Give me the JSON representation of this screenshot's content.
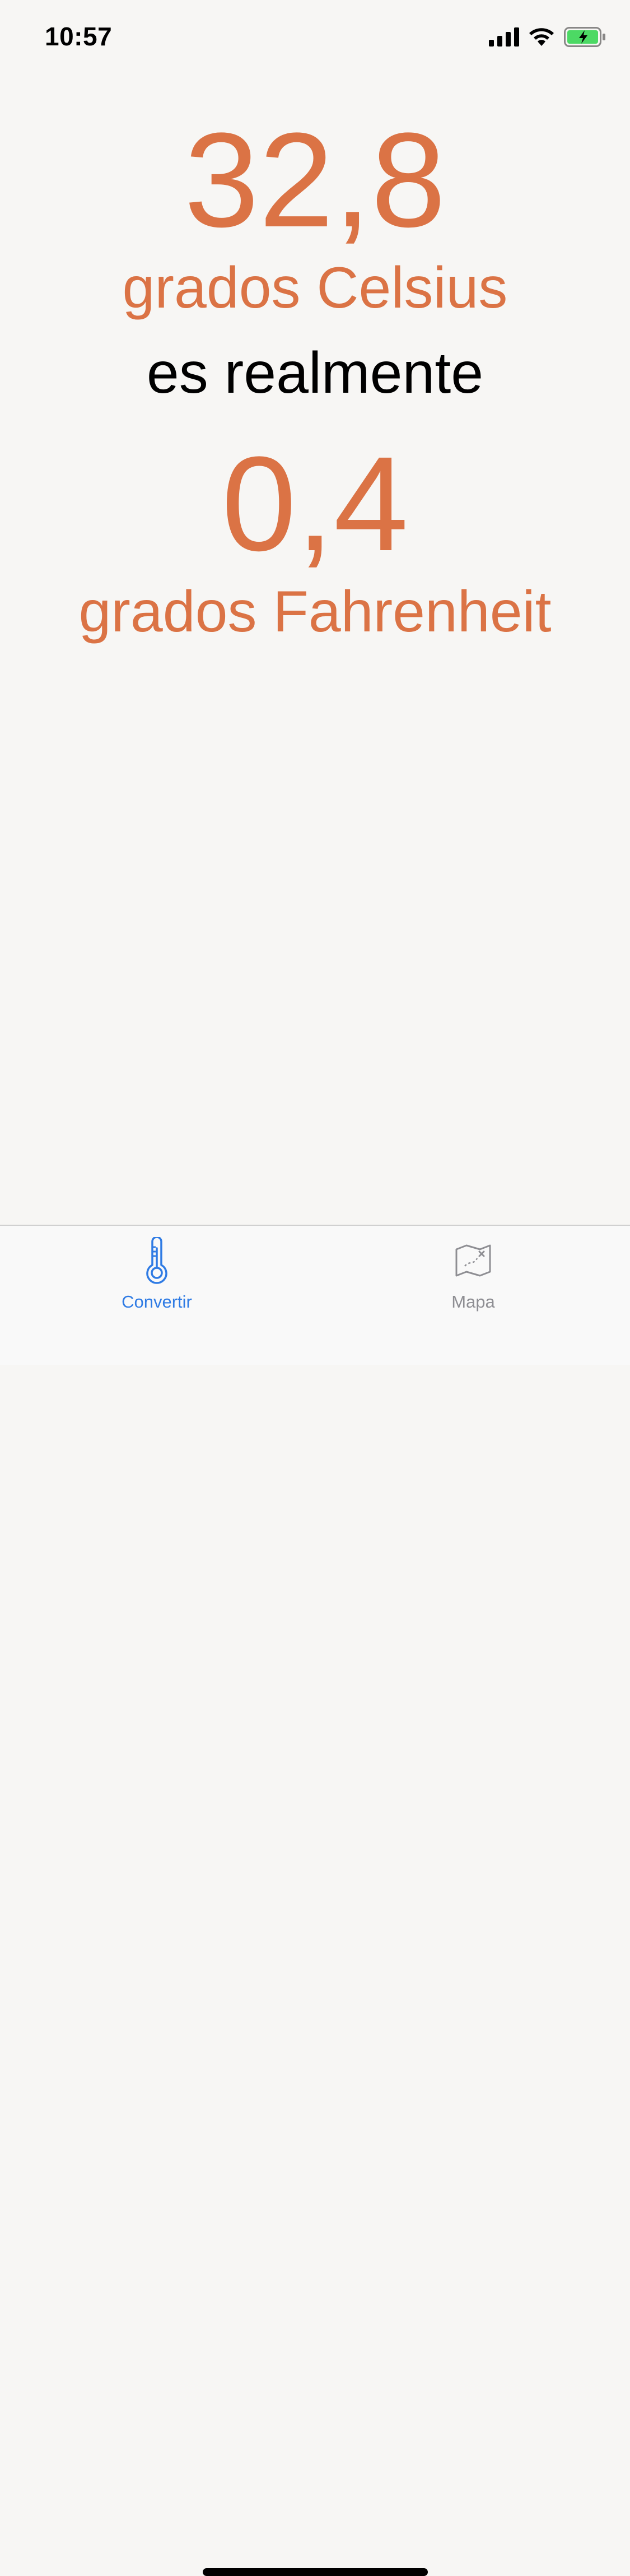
{
  "status_bar": {
    "time": "10:57",
    "icons": [
      "cellular-signal-icon",
      "wifi-icon",
      "battery-charging-icon"
    ],
    "battery_color": "#4CD964"
  },
  "conversion": {
    "celsius_value": "32,8",
    "celsius_unit": "grados Celsius",
    "connector": "es realmente",
    "fahrenheit_value": "0,4",
    "fahrenheit_unit": "grados Fahrenheit"
  },
  "tab_bar": {
    "tabs": [
      {
        "label": "Convertir",
        "icon": "thermometer-icon",
        "selected": true
      },
      {
        "label": "Mapa",
        "icon": "map-icon",
        "selected": false
      }
    ]
  },
  "colors": {
    "accent": "#DB7345",
    "tab_selected": "#2F7BE4",
    "tab_unselected": "#8E8E93",
    "background": "#F7F6F4"
  }
}
